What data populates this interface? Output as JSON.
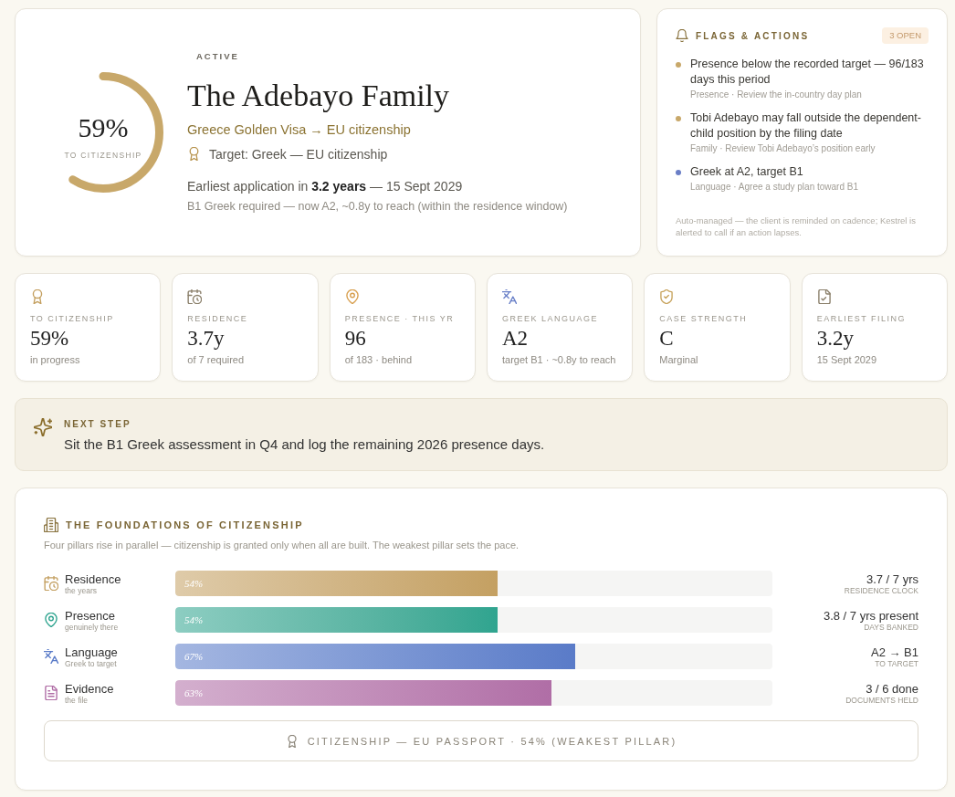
{
  "case": {
    "ring": {
      "level": 0.59,
      "value": "59%",
      "label": "TO CITIZENSHIP"
    },
    "status": "ACTIVE",
    "title": "The Adebayo Family",
    "route": "Greece Golden Visa → EU citizenship",
    "target": "Target: Greek — EU citizenship",
    "earliest": "Earliest application in **3.2 years** — 15 Sept 2029",
    "note": "B1 Greek required — now A2, ~0.8y to reach (within the residence window)"
  },
  "flags": {
    "title": "FLAGS & ACTIONS",
    "badge": "3 OPEN",
    "items": [
      {
        "title": "Presence below the recorded target — 96/183 days this period",
        "detail": "Presence · Review the in-country day plan",
        "color": "#c8a86a"
      },
      {
        "title": "Tobi Adebayo may fall outside the dependent-child position by the filing date",
        "detail": "Family · Review Tobi Adebayo’s position early",
        "color": "#c8a86a"
      },
      {
        "title": "Greek at A2, target B1",
        "detail": "Language · Agree a study plan toward B1",
        "color": "#6a7ec6"
      }
    ],
    "footer": "Auto-managed — the client is reminded on cadence; Kestrel is alerted to call if an action lapses."
  },
  "stats": [
    {
      "kind": "award",
      "label": "TO CITIZENSHIP",
      "value": "59%",
      "sub": "in progress"
    },
    {
      "kind": "calendar",
      "label": "RESIDENCE",
      "value": "3.7y",
      "sub": "of 7 required"
    },
    {
      "kind": "pin",
      "label": "PRESENCE · THIS YR",
      "value": "96",
      "sub": "of 183 · behind"
    },
    {
      "kind": "language",
      "label": "GREEK LANGUAGE",
      "value": "A2",
      "sub": "target B1 · ~0.8y to reach"
    },
    {
      "kind": "shield",
      "label": "CASE STRENGTH",
      "value": "C",
      "sub": "Marginal"
    },
    {
      "kind": "file",
      "label": "EARLIEST FILING",
      "value": "3.2y",
      "sub": "15 Sept 2029"
    }
  ],
  "next_step": {
    "label": "NEXT STEP",
    "text": "Sit the B1 Greek assessment in Q4 and log the remaining 2026 presence days."
  },
  "foundations": {
    "title": "THE FOUNDATIONS OF CITIZENSHIP",
    "description": "Four pillars rise in parallel — citizenship is granted only when all are built. The weakest pillar sets the pace.",
    "pillars": [
      {
        "kind": "calendar",
        "name": "Residence",
        "sub": "the years",
        "level": 0.54,
        "percent": "54%",
        "color": "#c4a062",
        "value": "3.7 / 7 yrs",
        "caption": "RESIDENCE CLOCK"
      },
      {
        "kind": "pin",
        "name": "Presence",
        "sub": "genuinely there",
        "level": 0.54,
        "percent": "54%",
        "color": "#2fa48f",
        "value": "3.8 / 7 yrs present",
        "caption": "DAYS BANKED"
      },
      {
        "kind": "language",
        "name": "Language",
        "sub": "Greek to target",
        "level": 0.67,
        "percent": "67%",
        "color": "#5a7bc8",
        "value": "A2 → B1",
        "caption": "TO TARGET"
      },
      {
        "kind": "document",
        "name": "Evidence",
        "sub": "the file",
        "level": 0.63,
        "percent": "63%",
        "color": "#b06ea6",
        "value": "3 / 6 done",
        "caption": "DOCUMENTS HELD"
      }
    ],
    "summary": "CITIZENSHIP — EU PASSPORT · 54% (WEAKEST PILLAR)"
  }
}
